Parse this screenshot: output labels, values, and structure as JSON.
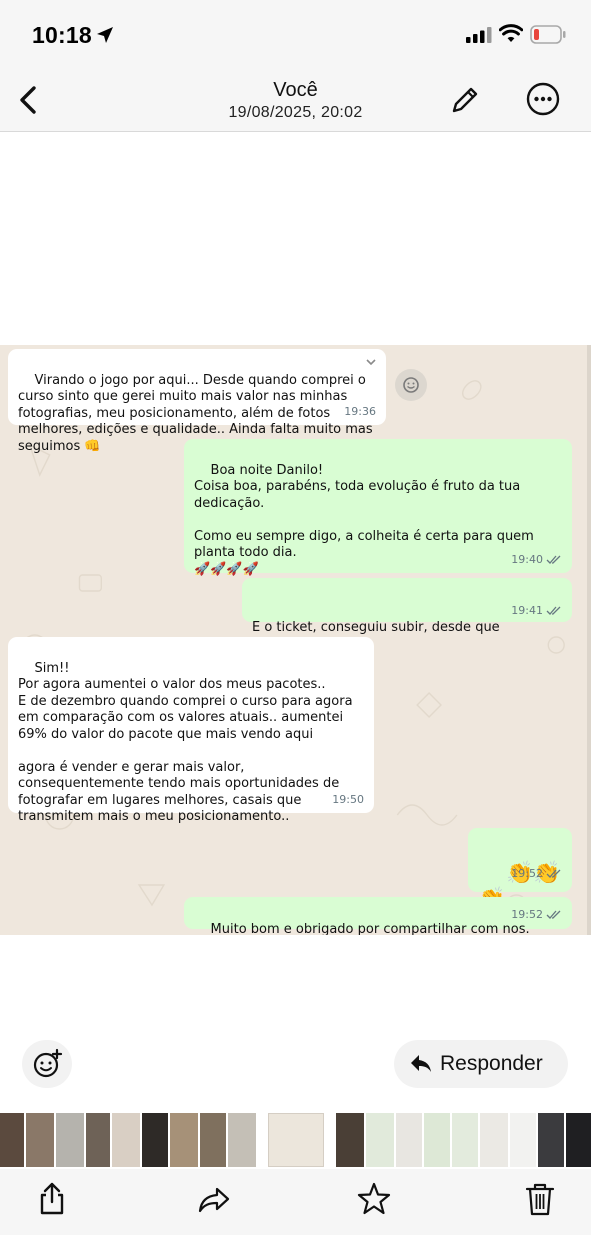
{
  "status_bar": {
    "time": "10:18"
  },
  "header": {
    "title": "Você",
    "subtitle": "19/08/2025, 20:02"
  },
  "messages": [
    {
      "direction": "in",
      "text": "Virando o jogo por aqui... Desde quando comprei o curso sinto que gerei muito mais valor nas minhas fotografias, meu posicionamento, além de fotos melhores, edições e qualidade.. Ainda falta muito mas seguimos 👊",
      "time": "19:36"
    },
    {
      "direction": "out",
      "text": "Boa noite Danilo!\nCoisa boa, parabéns, toda evolução é fruto da tua dedicação.\n\nComo eu sempre digo, a colheita é certa para quem planta todo dia.\n🚀🚀🚀🚀",
      "time": "19:40"
    },
    {
      "direction": "out",
      "text": "E o ticket, conseguiu subir, desde que começou ?",
      "time": "19:41"
    },
    {
      "direction": "in",
      "text": "Sim!!\nPor agora aumentei o valor dos meus pacotes..\nE de dezembro quando comprei o curso para agora em comparação com os valores atuais.. aumentei 69% do valor do pacote que mais vendo aqui\n\nagora é vender e gerar mais valor, consequentemente tendo mais oportunidades de fotografar em lugares melhores, casais que transmitem mais o meu posicionamento..",
      "time": "19:50"
    },
    {
      "direction": "out",
      "text": "👏👏👏",
      "time": "19:52"
    },
    {
      "direction": "out",
      "text": "Muito bom e obrigado por compartilhar com nos.",
      "time": "19:52"
    }
  ],
  "actions": {
    "reply_label": "Responder"
  },
  "icons": {
    "back": "chevron-left-icon",
    "edit": "pencil-icon",
    "more": "ellipsis-circle-icon",
    "sticker": "smiley-plus-icon",
    "reply": "reply-arrow-icon",
    "share": "share-icon",
    "forward": "forward-icon",
    "favorite": "star-icon",
    "delete": "trash-icon"
  },
  "colors": {
    "incoming_bubble": "#ffffff",
    "outgoing_bubble": "#d9fdd3",
    "chat_background": "#efe7dd",
    "read_ticks": "#667781"
  }
}
